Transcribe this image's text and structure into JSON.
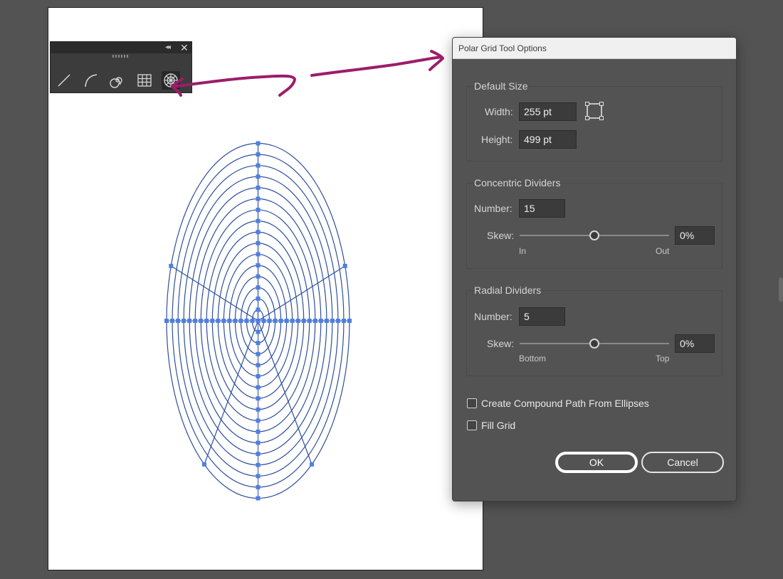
{
  "dialog": {
    "title": "Polar Grid Tool Options",
    "default_size": {
      "title": "Default Size",
      "width_label": "Width:",
      "width_value": "255 pt",
      "height_label": "Height:",
      "height_value": "499 pt"
    },
    "concentric": {
      "title": "Concentric Dividers",
      "number_label": "Number:",
      "number_value": "15",
      "skew_label": "Skew:",
      "skew_value": "0%",
      "skew_fraction": 0.5,
      "min_label": "In",
      "max_label": "Out"
    },
    "radial": {
      "title": "Radial Dividers",
      "number_label": "Number:",
      "number_value": "5",
      "skew_label": "Skew:",
      "skew_value": "0%",
      "skew_fraction": 0.5,
      "min_label": "Bottom",
      "max_label": "Top"
    },
    "compound_label": "Create Compound Path From Ellipses",
    "compound_checked": false,
    "fill_label": "Fill Grid",
    "fill_checked": false,
    "ok_label": "OK",
    "cancel_label": "Cancel"
  },
  "tool_panel": {
    "tools": [
      "line-segment-tool",
      "arc-tool",
      "spiral-tool",
      "rectangular-grid-tool",
      "polar-grid-tool"
    ],
    "active_tool": "polar-grid-tool"
  },
  "polar_grid": {
    "concentric_dividers": 15,
    "radial_dividers": 5,
    "stroke_color": "#2d4f9e",
    "anchor_color": "#4f7fe0"
  },
  "colors": {
    "annotation_arrow": "#9b1d6a",
    "workspace_bg": "#535353",
    "artboard_bg": "#ffffff"
  }
}
